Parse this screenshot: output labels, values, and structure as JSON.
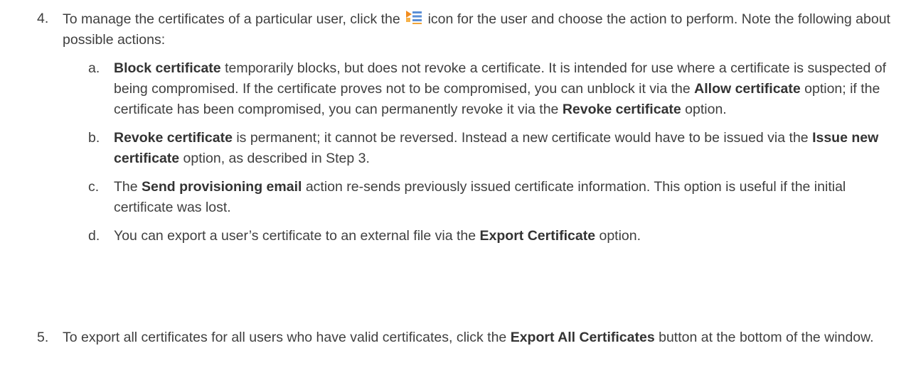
{
  "steps": [
    {
      "number": "4.",
      "text_before_icon": "To manage the certificates of a particular user, click the ",
      "icon": "action-menu-icon",
      "text_after_icon": " icon for the user and choose the action to perform. Note the following about possible actions:",
      "sub_items": [
        {
          "letter": "a.",
          "parts": [
            {
              "bold": true,
              "text": "Block certificate"
            },
            {
              "bold": false,
              "text": " temporarily blocks, but does not revoke a certificate. It is intended for use where a certificate is suspected of being compromised. If the certificate proves not to be compromised, you can unblock it via the "
            },
            {
              "bold": true,
              "text": "Allow certificate"
            },
            {
              "bold": false,
              "text": " option; if the certificate has been compromised, you can permanently revoke it via the "
            },
            {
              "bold": true,
              "text": "Revoke certificate"
            },
            {
              "bold": false,
              "text": " option."
            }
          ]
        },
        {
          "letter": "b.",
          "parts": [
            {
              "bold": true,
              "text": "Revoke certificate"
            },
            {
              "bold": false,
              "text": " is permanent; it cannot be reversed. Instead a new certificate would have to be issued via the "
            },
            {
              "bold": true,
              "text": "Issue new certificate"
            },
            {
              "bold": false,
              "text": " option, as described in Step 3."
            }
          ]
        },
        {
          "letter": "c.",
          "parts": [
            {
              "bold": false,
              "text": "The "
            },
            {
              "bold": true,
              "text": "Send provisioning email"
            },
            {
              "bold": false,
              "text": " action re-sends previously issued certificate information. This option is useful if the initial certificate was lost."
            }
          ]
        },
        {
          "letter": "d.",
          "parts": [
            {
              "bold": false,
              "text": "You can export a user’s certificate to an external file via the "
            },
            {
              "bold": true,
              "text": "Export Certificate"
            },
            {
              "bold": false,
              "text": " option."
            }
          ]
        }
      ]
    },
    {
      "number": "5.",
      "parts": [
        {
          "bold": false,
          "text": "To export all certificates for all users who have valid certificates, click the "
        },
        {
          "bold": true,
          "text": "Export All Certificates"
        },
        {
          "bold": false,
          "text": " button at the bottom of the window."
        }
      ]
    }
  ],
  "colors": {
    "text": "#3f3f3f",
    "icon_orange": "#f28c1e",
    "icon_blue": "#5b8fd6"
  }
}
